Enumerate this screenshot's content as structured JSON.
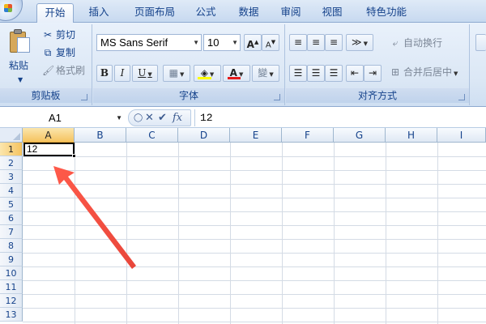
{
  "tabs": [
    "开始",
    "插入",
    "页面布局",
    "公式",
    "数据",
    "审阅",
    "视图",
    "特色功能"
  ],
  "active_tab": "开始",
  "clipboard": {
    "paste_label": "粘贴",
    "cut_label": "剪切",
    "copy_label": "复制",
    "format_painter_label": "格式刷",
    "group_label": "剪贴板"
  },
  "font": {
    "font_name": "MS Sans Serif",
    "font_size": "10",
    "grow_label": "A",
    "shrink_label": "A",
    "bold_label": "B",
    "italic_label": "I",
    "underline_label": "U",
    "font_color_label": "A",
    "phonetic_label": "變",
    "group_label": "字体"
  },
  "alignment": {
    "wrap_text_label": "自动换行",
    "merge_center_label": "合并后居中",
    "group_label": "对齐方式"
  },
  "formula_bar": {
    "name_box": "A1",
    "fx_label": "fx",
    "content": "12"
  },
  "sheet": {
    "columns": [
      "A",
      "B",
      "C",
      "D",
      "E",
      "F",
      "G",
      "H",
      "I"
    ],
    "rows": [
      "1",
      "2",
      "3",
      "4",
      "5",
      "6",
      "7",
      "8",
      "9",
      "10",
      "11",
      "12",
      "13"
    ],
    "selected_cell": "A1",
    "a1_value": "12"
  }
}
